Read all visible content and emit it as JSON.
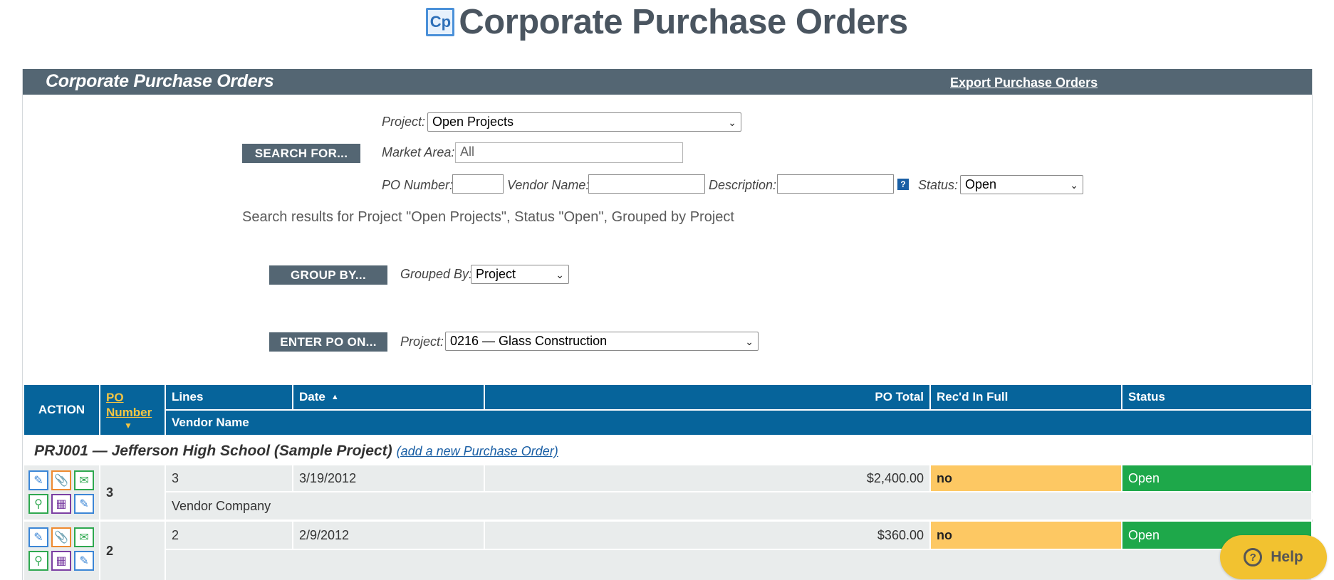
{
  "app": {
    "logo_text": "Cp",
    "title": "Corporate Purchase Orders"
  },
  "panel": {
    "title": "Corporate Purchase Orders",
    "export_label": "Export Purchase Orders"
  },
  "search": {
    "button_label": "SEARCH FOR...",
    "project_label": "Project:",
    "project_value": "Open Projects",
    "market_label": "Market Area:",
    "market_value": "All",
    "po_number_label": "PO Number:",
    "po_number_value": "",
    "vendor_label": "Vendor Name:",
    "vendor_value": "",
    "description_label": "Description:",
    "description_value": "",
    "help_glyph": "?",
    "status_label": "Status:",
    "status_value": "Open",
    "results_text": "Search results for Project \"Open Projects\", Status \"Open\", Grouped by Project"
  },
  "group": {
    "button_label": "GROUP BY...",
    "label": "Grouped By:",
    "value": "Project"
  },
  "enter": {
    "button_label": "ENTER PO ON...",
    "label": "Project:",
    "value": "0216 — Glass Construction"
  },
  "table": {
    "headers": {
      "action": "ACTION",
      "po_number_line1": "PO",
      "po_number_line2": "Number",
      "lines": "Lines",
      "date": "Date",
      "po_total": "PO Total",
      "recd": "Rec'd In Full",
      "status": "Status",
      "vendor": "Vendor Name"
    },
    "group_title": "PRJ001 — Jefferson High School (Sample Project)",
    "add_link": "(add a new Purchase Order)",
    "rows": [
      {
        "po": "3",
        "lines": "3",
        "date": "3/19/2012",
        "total": "$2,400.00",
        "recd": "no",
        "status": "Open",
        "vendor": "Vendor Company"
      },
      {
        "po": "2",
        "lines": "2",
        "date": "2/9/2012",
        "total": "$360.00",
        "recd": "no",
        "status": "Open",
        "vendor": ""
      }
    ],
    "action_icons": [
      "edit-icon",
      "attachment-icon",
      "email-icon",
      "view-icon",
      "calendar-icon",
      "edit-lines-icon"
    ]
  },
  "help_button": {
    "label": "Help",
    "glyph": "?"
  },
  "colors": {
    "header_bar": "#546673",
    "table_header": "#06649b",
    "recd_no": "#fdc863",
    "status_open": "#1ea84a",
    "help": "#f2c230"
  }
}
